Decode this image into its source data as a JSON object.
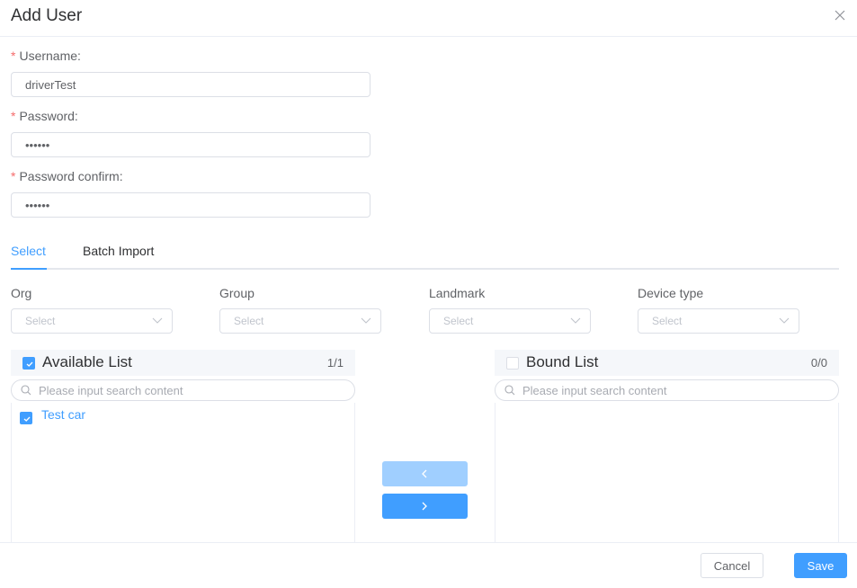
{
  "dialog": {
    "title": "Add User"
  },
  "form": {
    "username": {
      "label": "Username:",
      "required_mark": "*",
      "value": "driverTest"
    },
    "password": {
      "label": "Password:",
      "required_mark": "*",
      "value": "••••••"
    },
    "password_confirm": {
      "label": "Password confirm:",
      "required_mark": "*",
      "value": "••••••"
    }
  },
  "tabs": [
    {
      "label": "Select",
      "active": true
    },
    {
      "label": "Batch Import",
      "active": false
    }
  ],
  "filters": [
    {
      "label": "Org",
      "placeholder": "Select"
    },
    {
      "label": "Group",
      "placeholder": "Select"
    },
    {
      "label": "Landmark",
      "placeholder": "Select"
    },
    {
      "label": "Device type",
      "placeholder": "Select"
    }
  ],
  "transfer": {
    "available": {
      "title": "Available List",
      "count": "1/1",
      "all_checked": true,
      "search_placeholder": "Please input search content",
      "items": [
        {
          "label": "Test car",
          "checked": true
        }
      ]
    },
    "bound": {
      "title": "Bound List",
      "count": "0/0",
      "all_checked": false,
      "search_placeholder": "Please input search content",
      "items": []
    },
    "move_left_icon": "chevron-left-icon",
    "move_right_icon": "chevron-right-icon"
  },
  "footer": {
    "cancel_label": "Cancel",
    "save_label": "Save"
  },
  "colors": {
    "primary": "#409eff",
    "primary_disabled": "#a0cfff",
    "required": "#f56c6c"
  }
}
